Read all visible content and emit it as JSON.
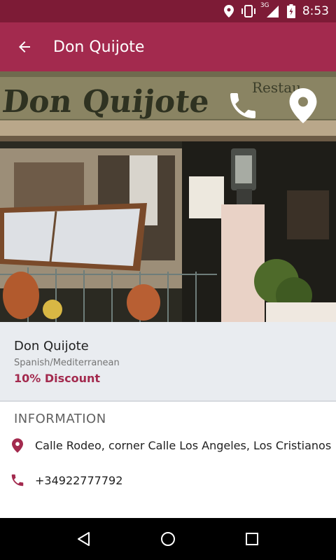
{
  "status_bar": {
    "time": "8:53",
    "network_label": "3G",
    "icons": [
      "location-icon",
      "vibrate-icon",
      "signal-icon",
      "battery-icon"
    ]
  },
  "app_bar": {
    "title": "Don Quijote",
    "back_icon": "arrow-back-icon"
  },
  "hero": {
    "actions": [
      "phone-icon",
      "location-pin-icon"
    ]
  },
  "restaurant": {
    "name": "Don Quijote",
    "cuisine": "Spanish/Mediterranean",
    "discount": "10% Discount"
  },
  "information": {
    "heading": "INFORMATION",
    "address": "Calle Rodeo, corner Calle Los Angeles, Los Cristianos",
    "phone": "+34922777792"
  },
  "nav_bar": {
    "buttons": [
      "back-triangle-icon",
      "home-circle-icon",
      "recents-square-icon"
    ]
  },
  "colors": {
    "status_bar": "#7d1b36",
    "app_bar": "#a32a4e",
    "accent": "#a32a4e",
    "card_bg": "#e9ecf0"
  }
}
